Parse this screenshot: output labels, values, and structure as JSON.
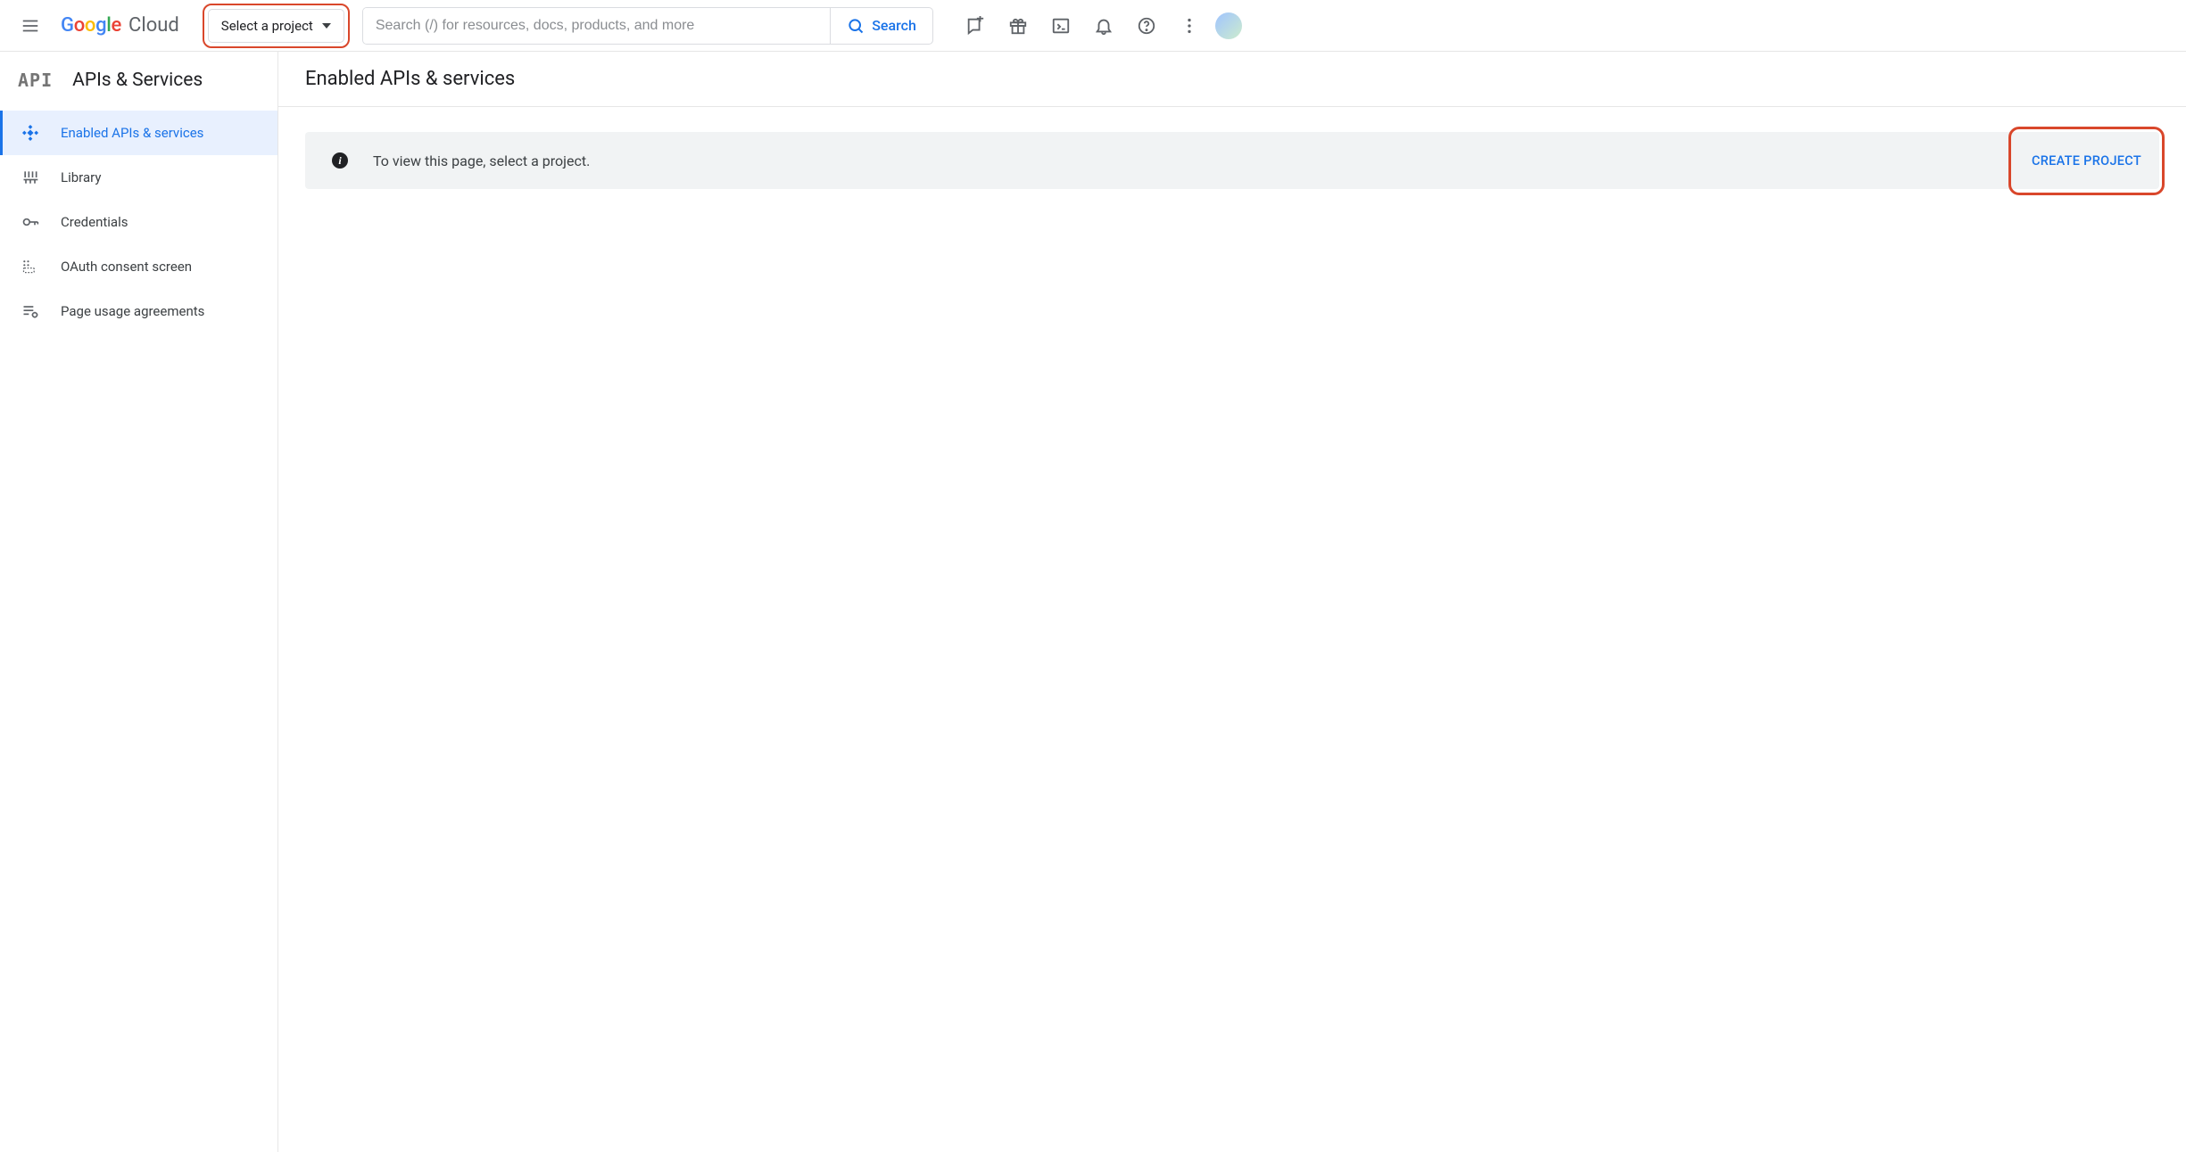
{
  "header": {
    "brand_word": "Google",
    "brand_suffix": "Cloud",
    "project_selector_label": "Select a project",
    "search_placeholder": "Search (/) for resources, docs, products, and more",
    "search_button_label": "Search"
  },
  "sidebar": {
    "api_badge": "API",
    "title": "APIs & Services",
    "items": [
      {
        "label": "Enabled APIs & services",
        "icon": "diamond",
        "active": true
      },
      {
        "label": "Library",
        "icon": "library",
        "active": false
      },
      {
        "label": "Credentials",
        "icon": "key",
        "active": false
      },
      {
        "label": "OAuth consent screen",
        "icon": "consent-screen",
        "active": false
      },
      {
        "label": "Page usage agreements",
        "icon": "list-gear",
        "active": false
      }
    ]
  },
  "main": {
    "title": "Enabled APIs & services",
    "banner_message": "To view this page, select a project.",
    "create_project_label": "CREATE PROJECT"
  },
  "colors": {
    "accent": "#1a73e8",
    "highlight_border": "#d9472b"
  }
}
